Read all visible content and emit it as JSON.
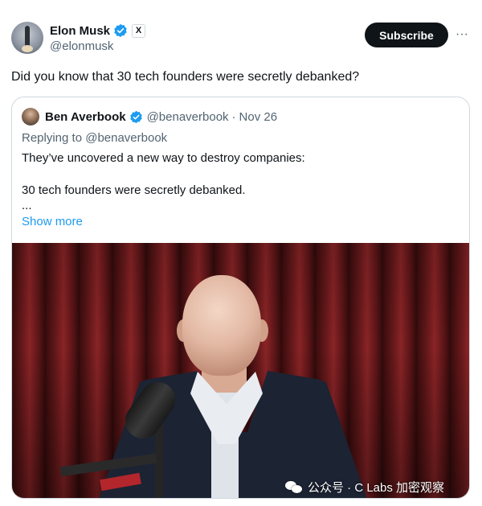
{
  "author": {
    "name": "Elon Musk",
    "handle": "@elonmusk",
    "verified_icon": "verified-badge-icon",
    "affiliate_badge": "X"
  },
  "actions": {
    "subscribe_label": "Subscribe",
    "more_label": "···"
  },
  "tweet": {
    "text": "Did you know that 30 tech founders were secretly debanked?"
  },
  "quote": {
    "author_name": "Ben Averbook",
    "handle": "@benaverbook",
    "separator": "·",
    "date": "Nov 26",
    "replying_to": "Replying to @benaverbook",
    "line1": "They’ve uncovered a new way to destroy companies:",
    "line2": "30 tech founders were secretly debanked.",
    "ellipsis": "...",
    "show_more": "Show more"
  },
  "watermark": {
    "text": "公众号 · C Labs 加密观察"
  },
  "colors": {
    "text": "#0f1419",
    "secondary": "#536471",
    "link": "#1d9bf0",
    "verified": "#1d9bf0",
    "border": "#cfd9de",
    "subscribe_bg": "#0f1419"
  }
}
